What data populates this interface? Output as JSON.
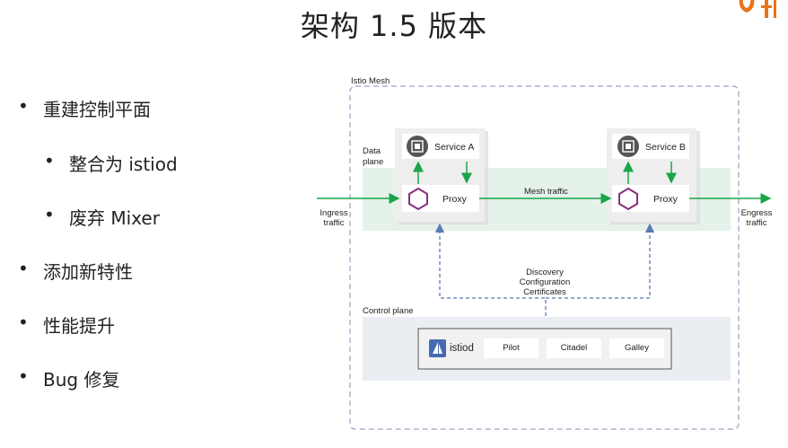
{
  "title": "架构 1.5 版本",
  "bullets": [
    {
      "text": "重建控制平面",
      "level": 1
    },
    {
      "text": "整合为 istiod",
      "level": 2
    },
    {
      "text": "废弃 Mixer",
      "level": 2
    },
    {
      "text": "添加新特性",
      "level": 1
    },
    {
      "text": "性能提升",
      "level": 1
    },
    {
      "text": "Bug 修复",
      "level": 1
    }
  ],
  "diagram": {
    "mesh_label": "Istio Mesh",
    "data_plane_label": "Data\nplane",
    "service_a": "Service A",
    "service_b": "Service B",
    "proxy_label": "Proxy",
    "mesh_traffic": "Mesh traffic",
    "ingress": "Ingress\ntraffic",
    "egress": "Engress\ntraffic",
    "discovery": "Discovery\nConfiguration\nCertificates",
    "control_plane_label": "Control plane",
    "istiod": "istiod",
    "components": [
      "Pilot",
      "Citadel",
      "Galley"
    ]
  },
  "colors": {
    "mesh_border": "#7d8fb5",
    "data_plane_bg": "#e4f2ea",
    "control_plane_bg": "#eaeef3",
    "arrow_green": "#1aa548",
    "dashed_blue": "#5b78b8",
    "hexagon": "#8a2e7c",
    "logo": "#e8731a"
  }
}
